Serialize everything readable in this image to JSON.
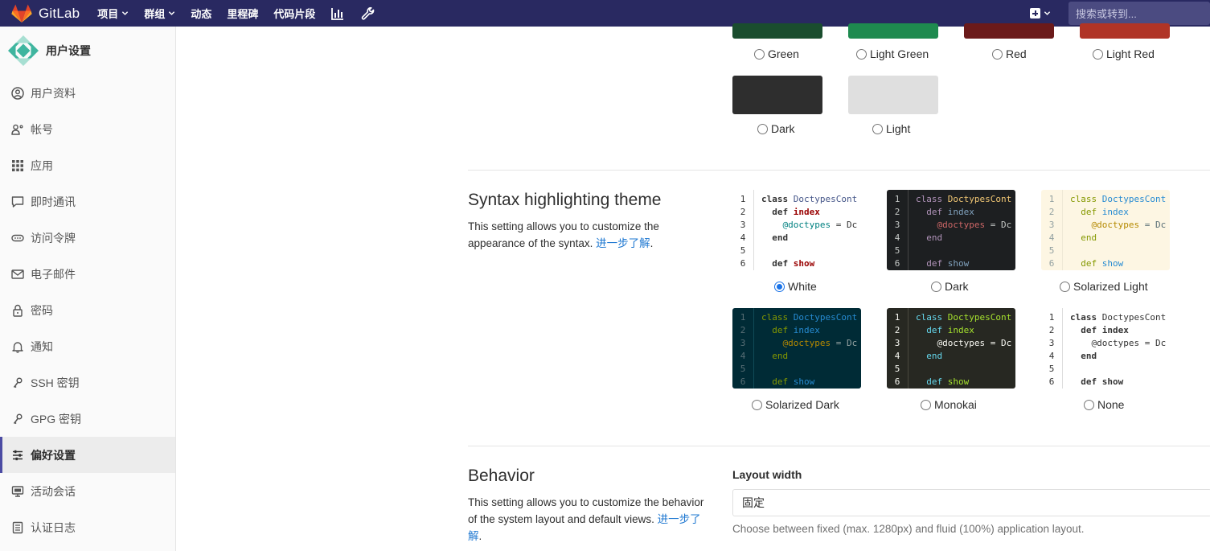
{
  "navbar": {
    "brand": "GitLab",
    "items": [
      "项目",
      "群组",
      "动态",
      "里程碑",
      "代码片段"
    ],
    "search_placeholder": "搜索或转到..."
  },
  "sidebar": {
    "title": "用户设置",
    "items": [
      "用户资料",
      "帐号",
      "应用",
      "即时通讯",
      "访问令牌",
      "电子邮件",
      "密码",
      "通知",
      "SSH 密钥",
      "GPG 密钥",
      "偏好设置",
      "活动会话",
      "认证日志"
    ],
    "active": "偏好设置"
  },
  "navigation_theme": {
    "options": [
      {
        "label": "Green",
        "color": "#1a4d2e"
      },
      {
        "label": "Light Green",
        "color": "#1e8a4f"
      },
      {
        "label": "Red",
        "color": "#6b1a1a"
      },
      {
        "label": "Light Red",
        "color": "#b03426"
      },
      {
        "label": "Dark",
        "color": "#2e2e2e"
      },
      {
        "label": "Light",
        "color": "#dfdfdf"
      }
    ]
  },
  "syntax": {
    "title": "Syntax highlighting theme",
    "description": "This setting allows you to customize the appearance of the syntax.",
    "learn_more": "进一步了解",
    "options": [
      "White",
      "Dark",
      "Solarized Light",
      "Solarized Dark",
      "Monokai",
      "None"
    ],
    "selected": "White",
    "code_lines": [
      "class DoctypesCont",
      "  def index",
      "    @doctypes = Dc",
      "  end",
      "",
      "  def show"
    ]
  },
  "behavior": {
    "title": "Behavior",
    "description": "This setting allows you to customize the behavior of the system layout and default views.",
    "learn_more": "进一步了解",
    "layout_label": "Layout width",
    "layout_value": "固定",
    "layout_help": "Choose between fixed (max. 1280px) and fluid (100%) application layout."
  }
}
